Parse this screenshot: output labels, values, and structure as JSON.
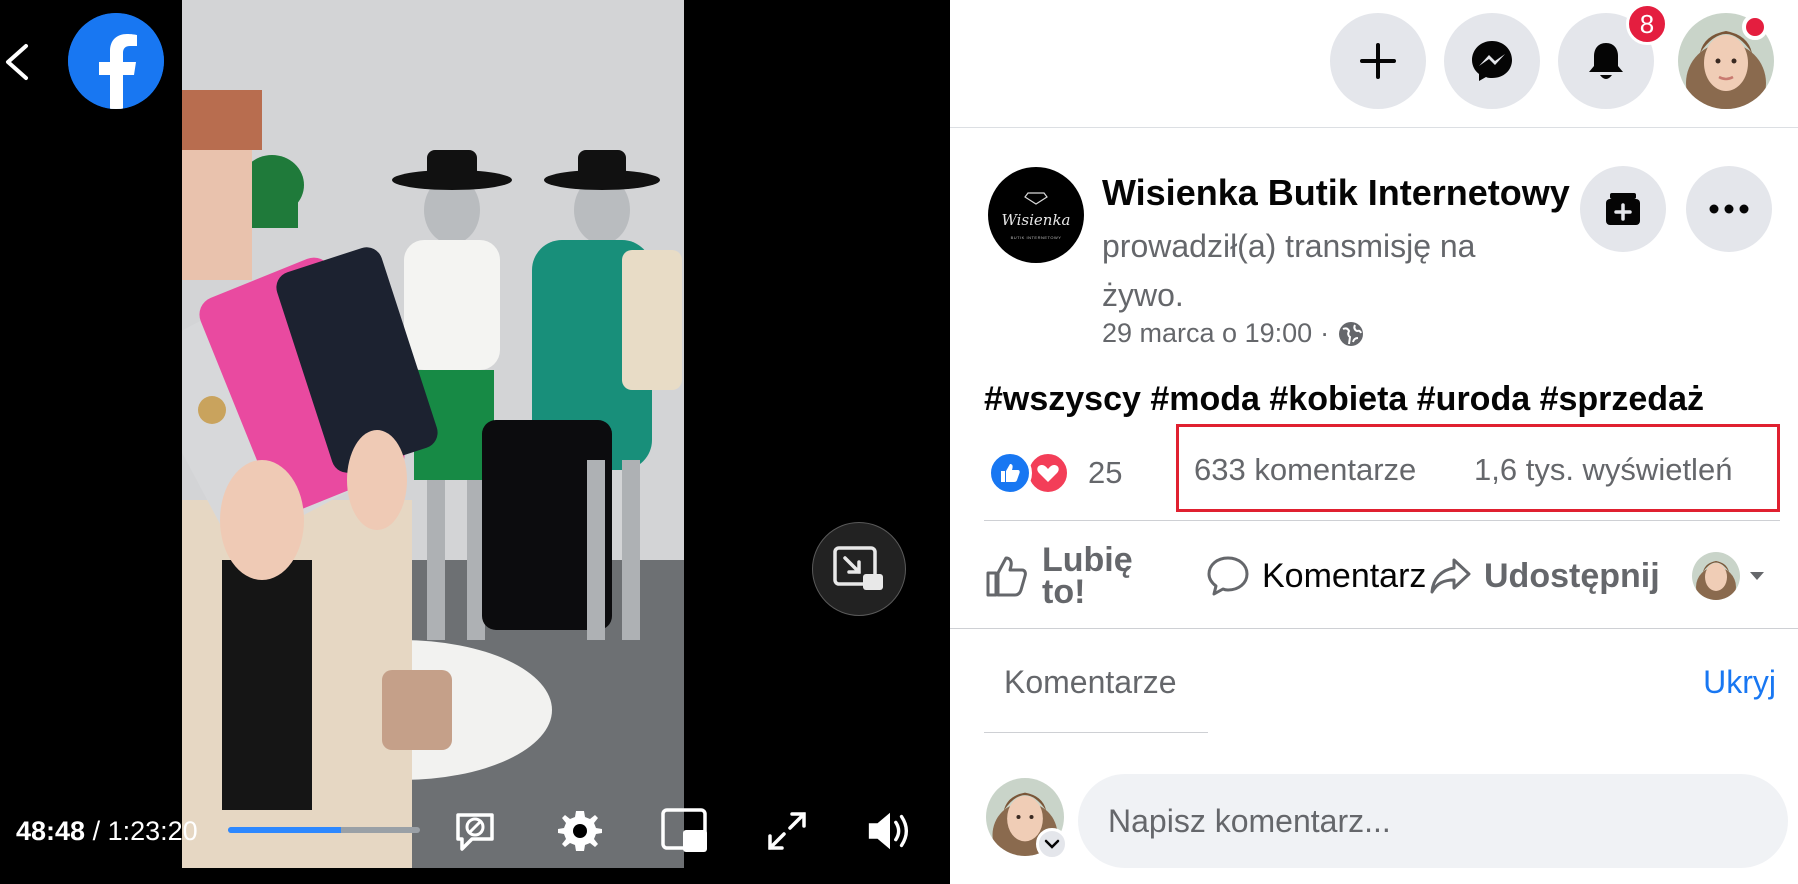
{
  "video": {
    "current_time": "48:48",
    "separator": "/",
    "duration": "1:23:20",
    "progress_fraction": 0.59
  },
  "topbar": {
    "notification_count": "8"
  },
  "post": {
    "page_name": "Wisienka Butik Internetowy",
    "subtitle": "prowadził(a) transmisję na żywo.",
    "date": "29 marca o 19:00",
    "meta_sep": "·",
    "logo_script": "Wisienka",
    "logo_tag": "BUTIK INTERNETOWY",
    "hashtags": "#wszyscy #moda #kobieta #uroda #sprzedaż",
    "reaction_count": "25",
    "comments_count": "633 komentarze",
    "views_count": "1,6 tys. wyświetleń"
  },
  "actions": {
    "like": "Lubię to!",
    "comment": "Komentarz",
    "share": "Udostępnij"
  },
  "comments": {
    "tab_label": "Komentarze",
    "hide_label": "Ukryj",
    "placeholder": "Napisz komentarz..."
  },
  "colors": {
    "facebook_blue": "#1877f2",
    "badge_red": "#e41e3f",
    "highlight_red": "#e02030",
    "secondary_text": "#65676b"
  }
}
